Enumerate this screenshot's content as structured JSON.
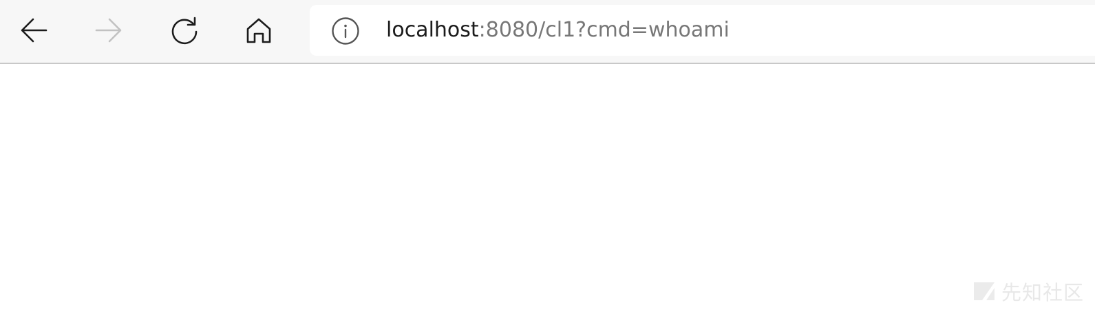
{
  "toolbar": {
    "back_icon": "arrow-left-icon",
    "forward_icon": "arrow-right-icon",
    "refresh_icon": "refresh-icon",
    "home_icon": "home-icon",
    "forward_enabled": false
  },
  "address_bar": {
    "info_icon": "info-circle-icon",
    "host": "localhost",
    "rest": ":8080/cl1?cmd=whoami"
  },
  "watermark": {
    "text": "先知社区"
  },
  "colors": {
    "toolbar_bg": "#f7f7f7",
    "address_bg": "#ffffff",
    "url_host": "#1b1b1b",
    "url_rest": "#777777",
    "icon_active": "#1b1b1b",
    "icon_disabled": "#c2c2c2"
  }
}
